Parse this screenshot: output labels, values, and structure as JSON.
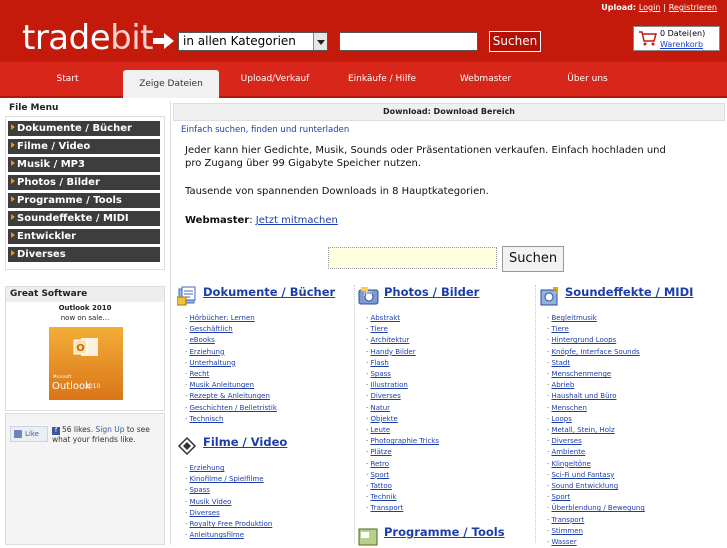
{
  "header": {
    "logo_part1": "trade",
    "logo_part2": "bit",
    "category_select": "in allen Kategorien",
    "search_button": "Suchen",
    "upload_label": "Upload:",
    "login_link": "Login",
    "separator": "|",
    "register_link": "Registrieren",
    "cart_count": "0  Datei(en)",
    "cart_link": "Warenkorb"
  },
  "nav": {
    "tabs": [
      {
        "label": "Start"
      },
      {
        "label": "Zeige Dateien"
      },
      {
        "label": "Upload/Verkauf"
      },
      {
        "label": "Einkäufe / Hilfe"
      },
      {
        "label": "Webmaster"
      },
      {
        "label": "Über uns"
      }
    ]
  },
  "sidebar": {
    "file_menu_title": "File Menu",
    "items": [
      "Dokumente / Bücher",
      "Filme / Video",
      "Musik / MP3",
      "Photos / Bilder",
      "Programme / Tools",
      "Soundeffekte / MIDI",
      "Entwickler",
      "Diverses"
    ],
    "great_software": "Great Software",
    "product_name": "Outlook 2010",
    "product_sub": "now on sale...",
    "product_logo": "Outlook",
    "product_year": "2010",
    "product_ms": "Microsoft",
    "like_button": "Like",
    "like_count": "56 likes.",
    "like_signup": "Sign Up",
    "like_rest": "to see what your friends like."
  },
  "main": {
    "bar_title": "Download: Download Bereich",
    "intro_link": "Einfach suchen, finden und runterladen",
    "intro_text": "Jeder kann hier Gedichte, Musik, Sounds oder Präsentationen verkaufen. Einfach hochladen und pro Zugang über 99 Gigabyte Speicher nutzen.",
    "intro_text2": "Tausende von spannenden Downloads in 8 Hauptkategorien.",
    "webmaster_label": "Webmaster",
    "webmaster_colon": ": ",
    "webmaster_link": "Jetzt mitmachen",
    "search_button": "Suchen"
  },
  "categories": {
    "docs": {
      "title": "Dokumente / Bücher",
      "items": [
        "Hörbücher: Lernen",
        "Geschäftlich",
        "eBooks",
        "Erziehung",
        "Unterhaltung",
        "Recht",
        "Musik Anleitungen",
        "Rezepte & Anleitungen",
        "Geschichten / Belletristik",
        "Technisch"
      ]
    },
    "film": {
      "title": "Filme / Video",
      "items": [
        "Erziehung",
        "Kinofilme / Spielfilme",
        "Spass",
        "Musik Video",
        "Diverses",
        "Royalty Free Produktion",
        "Anleitungsfilme"
      ]
    },
    "photo": {
      "title": "Photos / Bilder",
      "items": [
        "Abstrakt",
        "Tiere",
        "Architektur",
        "Handy Bilder",
        "Flash",
        "Spass",
        "Illustration",
        "Diverses",
        "Natur",
        "Objekte",
        "Leute",
        "Photographie Tricks",
        "Plätze",
        "Retro",
        "Sport",
        "Tattoo",
        "Technik",
        "Transport"
      ]
    },
    "prog": {
      "title": "Programme / Tools"
    },
    "sound": {
      "title": "Soundeffekte / MIDI",
      "items": [
        "Begleitmusik",
        "Tiere",
        "Hintergrund Loops",
        "Knöpfe, Interface Sounds",
        "Stadt",
        "Menschenmenge",
        "Abrieb",
        "Haushalt und Büro",
        "Menschen",
        "Loops",
        "Metall, Stein, Holz",
        "Diverses",
        "Ambiente",
        "Klingeltöne",
        "Sci-Fi und Fantasy",
        "Sound Entwicklung",
        "Sport",
        "Überblendung / Bewegung",
        "Transport",
        "Stimmen",
        "Wasser"
      ]
    }
  },
  "colors": {
    "brand_red": "#c41a0c",
    "nav_red": "#d9261b",
    "link_blue": "#1c3eab",
    "menu_dark": "#3d3d3d"
  }
}
